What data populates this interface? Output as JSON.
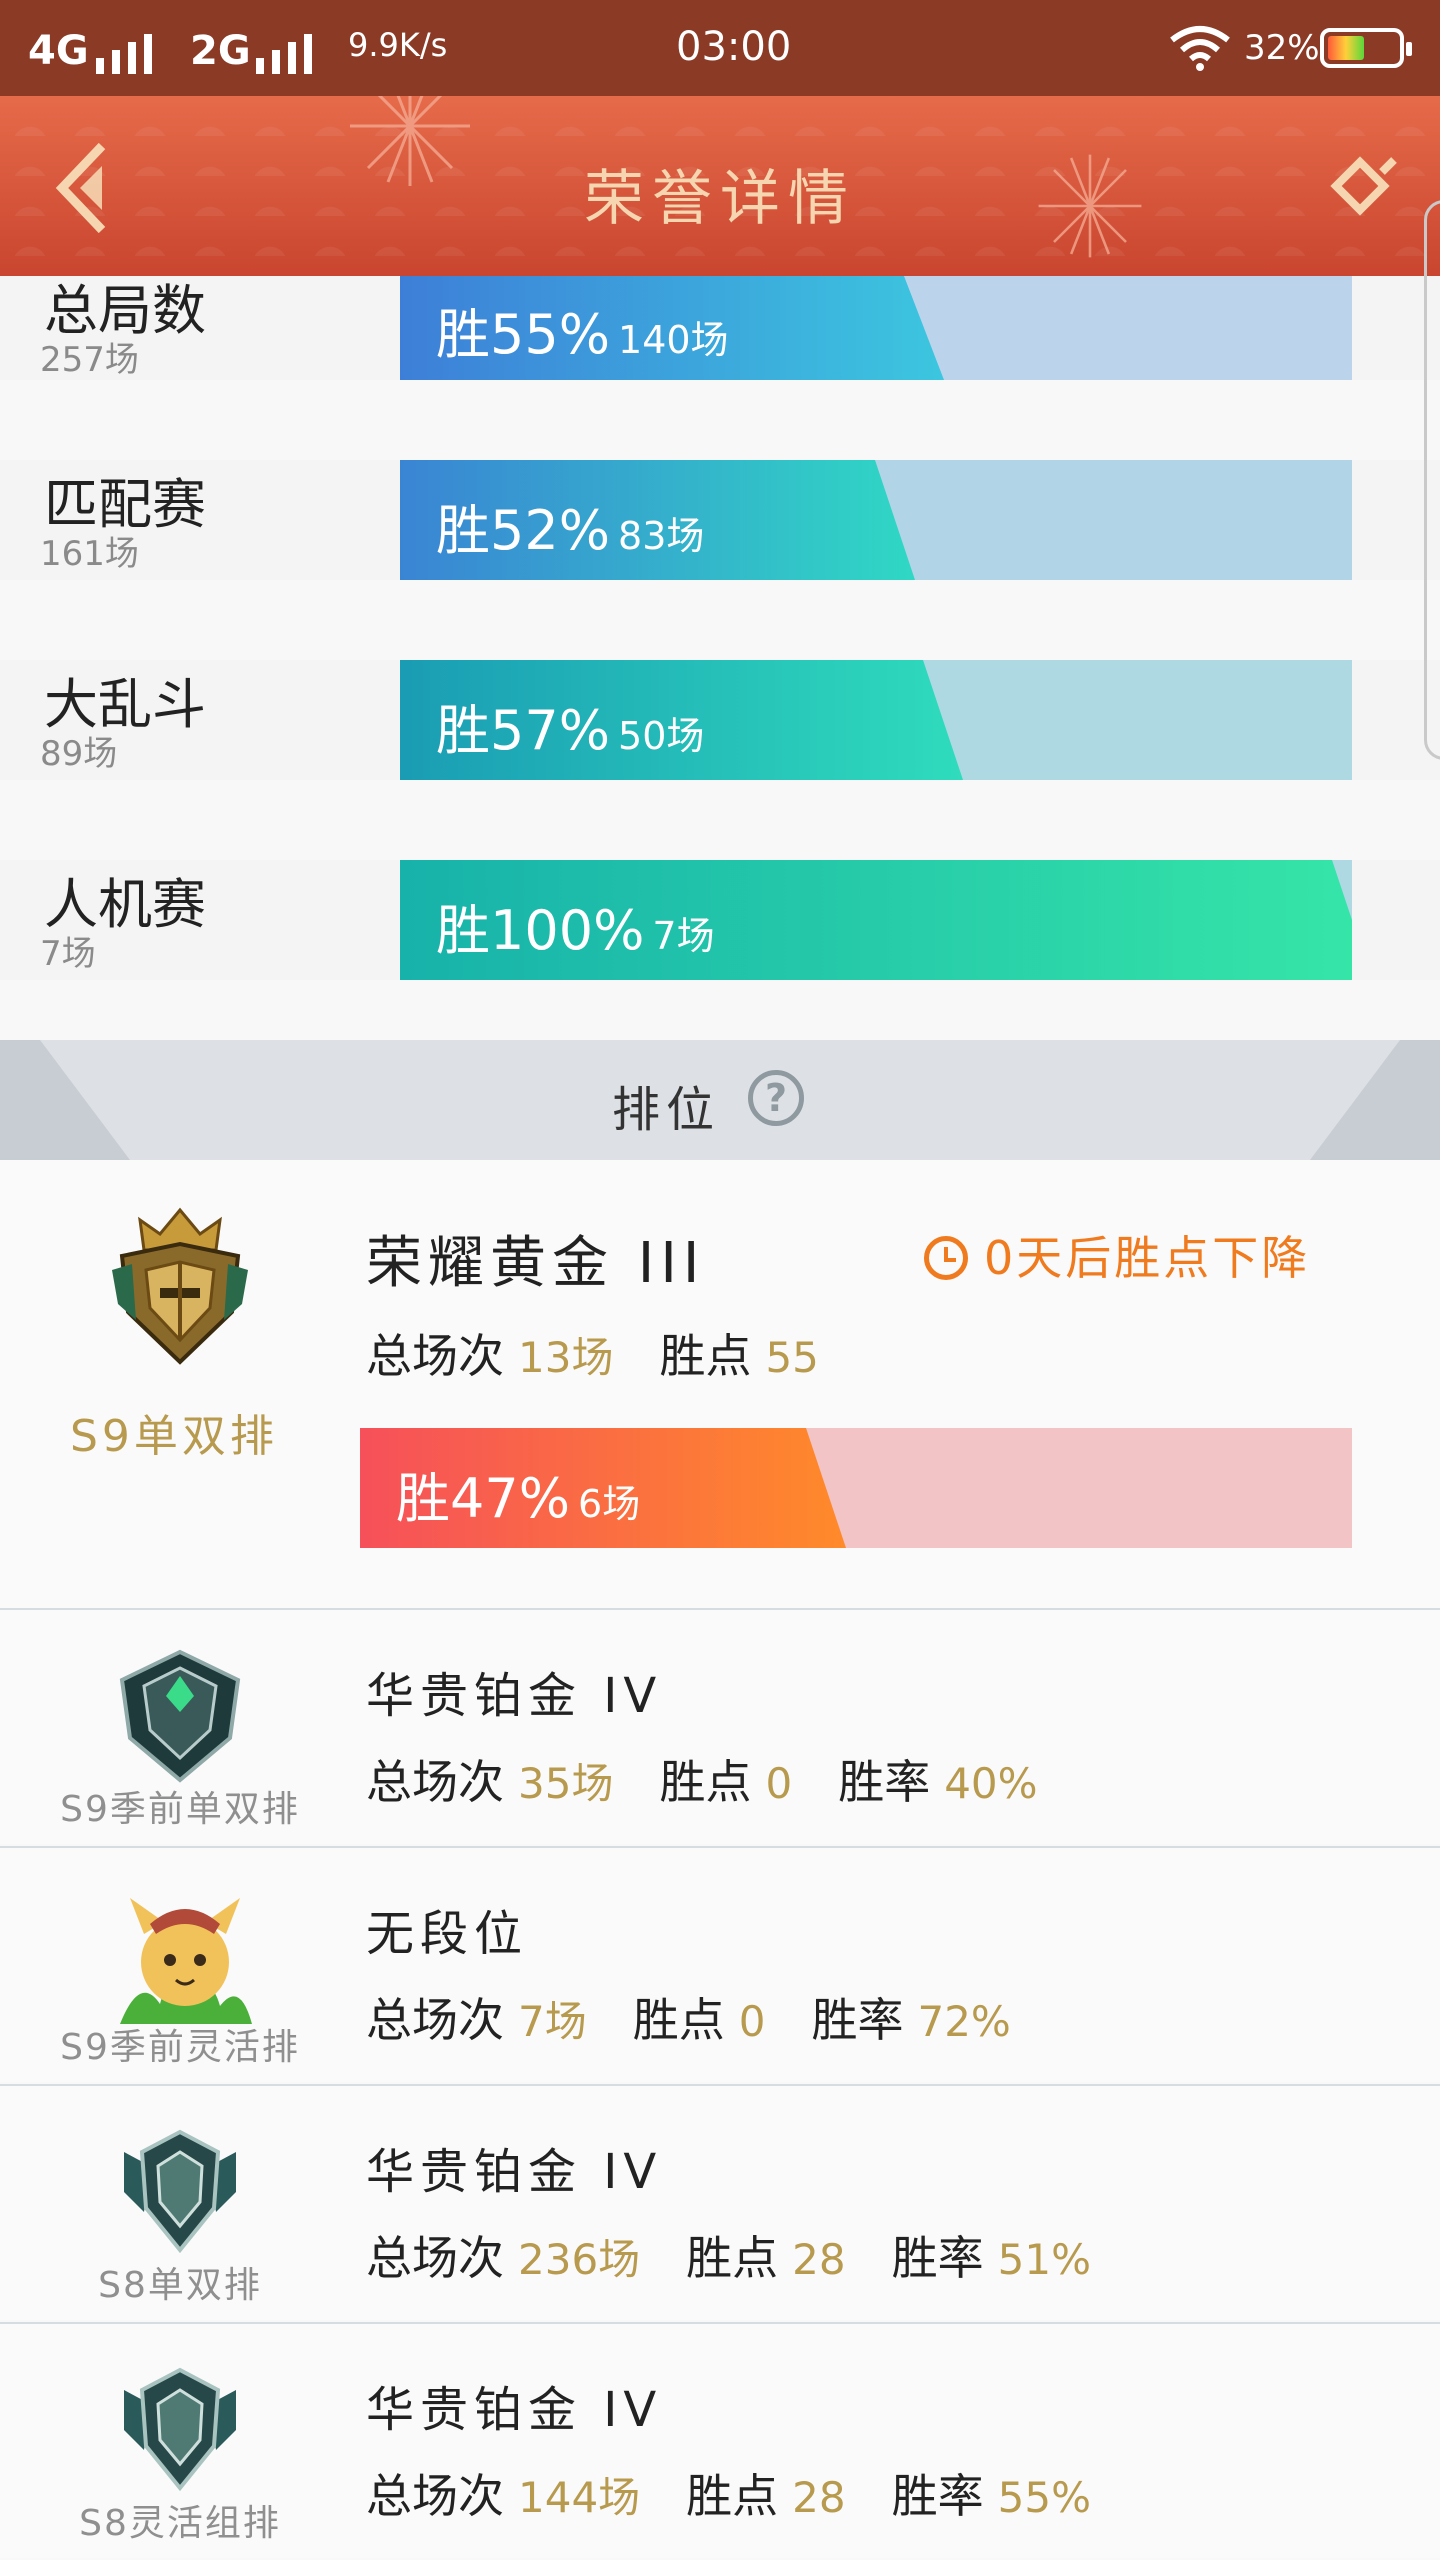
{
  "status_bar": {
    "net1": "4G",
    "net2": "2G",
    "speed": "9.9K/s",
    "time": "03:00",
    "battery": "32%"
  },
  "header": {
    "title": "荣誉详情",
    "back_icon": "back-chevron-icon",
    "share_icon": "share-icon"
  },
  "modes": [
    {
      "name": "总局数",
      "count": "257场",
      "win_label": "胜55%",
      "games": "140场",
      "win_rate": 0.55,
      "color_from": "#3d7fd8",
      "color_to": "#3cc6df"
    },
    {
      "name": "匹配赛",
      "count": "161场",
      "win_label": "胜52%",
      "games": "83场",
      "win_rate": 0.52,
      "color_from": "#3a84d4",
      "color_to": "#2fd8c4"
    },
    {
      "name": "大乱斗",
      "count": "89场",
      "win_label": "胜57%",
      "games": "50场",
      "win_rate": 0.57,
      "color_from": "#1a9cb4",
      "color_to": "#2fdcbc"
    },
    {
      "name": "人机赛",
      "count": "7场",
      "win_label": "胜100%",
      "games": "7场",
      "win_rate": 1.0,
      "color_from": "#17b2aa",
      "color_to": "#36e6a8"
    }
  ],
  "ranking": {
    "title": "排位",
    "help_icon": "help-question-icon",
    "help_glyph": "?",
    "current": {
      "queue": "S9单双排",
      "tier": "荣耀黄金 III",
      "decay_text": "0天后胜点下降",
      "total_label": "总场次",
      "total": "13场",
      "points_label": "胜点",
      "points": "55",
      "win_label": "胜47%",
      "win_games": "6场",
      "win_rate": 0.47
    },
    "history": [
      {
        "queue": "S9季前单双排",
        "tier": "华贵铂金 IV",
        "total_label": "总场次",
        "total": "35场",
        "points_label": "胜点",
        "points": "0",
        "rate_label": "胜率",
        "rate": "40%"
      },
      {
        "queue": "S9季前灵活排",
        "tier": "无段位",
        "total_label": "总场次",
        "total": "7场",
        "points_label": "胜点",
        "points": "0",
        "rate_label": "胜率",
        "rate": "72%"
      },
      {
        "queue": "S8单双排",
        "tier": "华贵铂金 IV",
        "total_label": "总场次",
        "total": "236场",
        "points_label": "胜点",
        "points": "28",
        "rate_label": "胜率",
        "rate": "51%"
      },
      {
        "queue": "S8灵活组排",
        "tier": "华贵铂金 IV",
        "total_label": "总场次",
        "total": "144场",
        "points_label": "胜点",
        "points": "28",
        "rate_label": "胜率",
        "rate": "55%"
      }
    ]
  }
}
